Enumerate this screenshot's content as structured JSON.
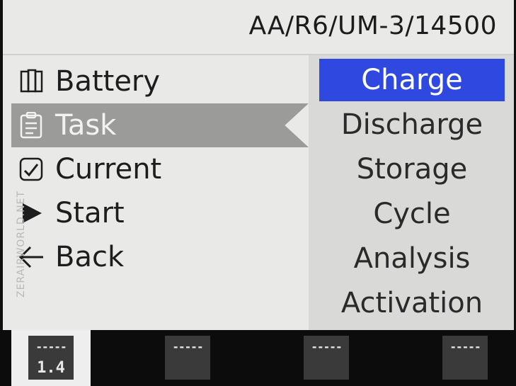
{
  "header": {
    "battery_type": "AA/R6/UM-3/14500"
  },
  "menu": {
    "items": [
      {
        "label": "Battery",
        "icon": "battery-icon"
      },
      {
        "label": "Task",
        "icon": "clipboard-icon",
        "selected": true
      },
      {
        "label": "Current",
        "icon": "chart-check-icon"
      },
      {
        "label": "Start",
        "icon": "play-icon"
      },
      {
        "label": "Back",
        "icon": "back-arrow-icon"
      }
    ]
  },
  "task_options": {
    "items": [
      "Charge",
      "Discharge",
      "Storage",
      "Cycle",
      "Analysis",
      "Activation"
    ],
    "selected": "Charge"
  },
  "watermark": "ZERAIRWORLD.NET",
  "softkeys": [
    {
      "top": "-----",
      "bottom": "1.4"
    },
    {
      "top": "-----",
      "bottom": ""
    },
    {
      "top": "-----",
      "bottom": ""
    },
    {
      "top": "-----",
      "bottom": ""
    }
  ],
  "colors": {
    "accent": "#2f49e0",
    "selected_row": "#9b9b99",
    "panel": "#d9d9d7",
    "screen": "#e9e9e7"
  }
}
